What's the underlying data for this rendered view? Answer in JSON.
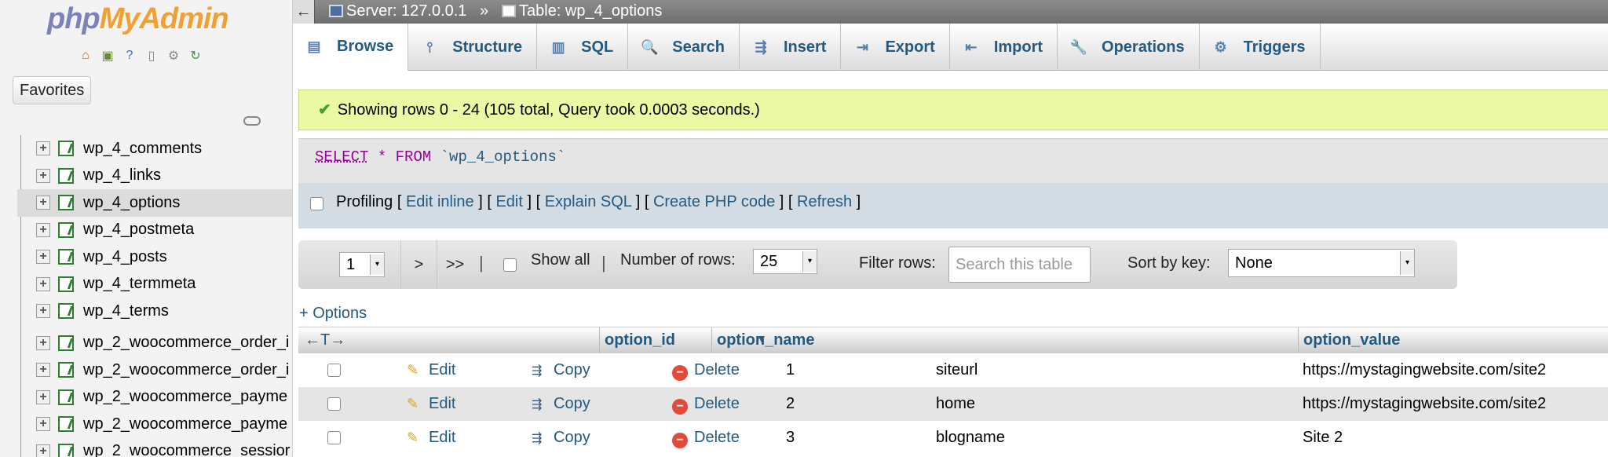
{
  "nav": {
    "logo_php": "php",
    "logo_myadmin": "MyAdmin",
    "quick_icons": [
      "home-icon",
      "exit-icon",
      "help-icon",
      "docs-icon",
      "settings-icon",
      "reload-icon"
    ],
    "favorites_label": "Favorites",
    "tables": [
      {
        "name": "wp_4_comments",
        "selected": false
      },
      {
        "name": "wp_4_links",
        "selected": false
      },
      {
        "name": "wp_4_options",
        "selected": true
      },
      {
        "name": "wp_4_postmeta",
        "selected": false
      },
      {
        "name": "wp_4_posts",
        "selected": false
      },
      {
        "name": "wp_4_termmeta",
        "selected": false
      },
      {
        "name": "wp_4_terms",
        "selected": false
      },
      {
        "name": "wp_2_woocommerce_order_i",
        "selected": false
      },
      {
        "name": "wp_2_woocommerce_order_i",
        "selected": false
      },
      {
        "name": "wp_2_woocommerce_payme",
        "selected": false
      },
      {
        "name": "wp_2_woocommerce_payme",
        "selected": false
      },
      {
        "name": "wp_2_woocommerce_sessior",
        "selected": false
      }
    ]
  },
  "topbar": {
    "back_arrow": "←",
    "server": "Server: 127.0.0.1",
    "separator": "»",
    "table": "Table: wp_4_options"
  },
  "tabs": [
    {
      "label": "Browse",
      "icon": "browse-icon",
      "glyph": "▤",
      "active": true
    },
    {
      "label": "Structure",
      "icon": "structure-icon",
      "glyph": "⫯",
      "active": false
    },
    {
      "label": "SQL",
      "icon": "sql-icon",
      "glyph": "▥",
      "active": false
    },
    {
      "label": "Search",
      "icon": "search-icon",
      "glyph": "🔍",
      "active": false
    },
    {
      "label": "Insert",
      "icon": "insert-icon",
      "glyph": "⇶",
      "active": false
    },
    {
      "label": "Export",
      "icon": "export-icon",
      "glyph": "⇥",
      "active": false
    },
    {
      "label": "Import",
      "icon": "import-icon",
      "glyph": "⇤",
      "active": false
    },
    {
      "label": "Operations",
      "icon": "wrench-icon",
      "glyph": "🔧",
      "active": false
    },
    {
      "label": "Triggers",
      "icon": "triggers-icon",
      "glyph": "⚙",
      "active": false
    }
  ],
  "success_message": "Showing rows 0 - 24 (105 total, Query took 0.0003 seconds.)",
  "sql": {
    "select": "SELECT",
    "star": "*",
    "from": "FROM",
    "table": "`wp_4_options`"
  },
  "profiling": {
    "label": "Profiling",
    "links": [
      "Edit inline",
      "Edit",
      "Explain SQL",
      "Create PHP code",
      "Refresh"
    ]
  },
  "navigation": {
    "page": "1",
    "next": ">",
    "last": ">>",
    "pipe": "|",
    "show_all": "Show all",
    "rows_label": "Number of rows:",
    "rows_value": "25",
    "filter_label": "Filter rows:",
    "filter_placeholder": "Search this table",
    "sort_label": "Sort by key:",
    "sort_value": "None"
  },
  "options_link": "+ Options",
  "table": {
    "col_arrows": "←T→",
    "columns": [
      "option_id",
      "option_name",
      "option_value"
    ],
    "actions": {
      "edit": "Edit",
      "copy": "Copy",
      "delete": "Delete"
    },
    "rows": [
      {
        "option_id": "1",
        "option_name": "siteurl",
        "option_value": "https://mystagingwebsite.com/site2"
      },
      {
        "option_id": "2",
        "option_name": "home",
        "option_value": "https://mystagingwebsite.com/site2"
      },
      {
        "option_id": "3",
        "option_name": "blogname",
        "option_value": "Site 2"
      }
    ]
  },
  "colors": {
    "link": "#235a81",
    "success_bg": "#ebf8a4",
    "topbar": "#7f7f7f",
    "logo_php": "#7b82b8",
    "logo_myadmin": "#f1a131"
  }
}
